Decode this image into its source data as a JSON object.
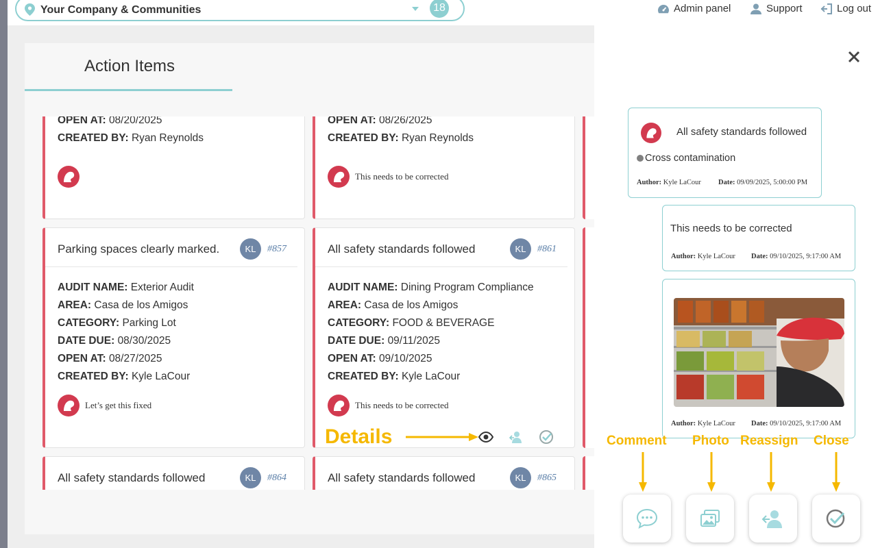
{
  "header": {
    "company_name": "Your Company & Communities",
    "count": "18",
    "admin_label": "Admin panel",
    "support_label": "Support",
    "logout_label": "Log out"
  },
  "panel": {
    "title": "Action Items"
  },
  "cards": {
    "top_left": {
      "open_at_label": "OPEN AT:",
      "open_at": "08/20/2025",
      "created_by_label": "CREATED BY:",
      "created_by": "Ryan Reynolds",
      "comment": ""
    },
    "top_mid": {
      "open_at_label": "OPEN AT:",
      "open_at": "08/26/2025",
      "created_by_label": "CREATED BY:",
      "created_by": "Ryan Reynolds",
      "comment": "This needs to be corrected"
    },
    "mid_left": {
      "title": "Parking spaces clearly marked.",
      "avatar": "KL",
      "number": "#857",
      "audit_label": "AUDIT NAME:",
      "audit": "Exterior Audit",
      "area_label": "AREA:",
      "area": "Casa de los Amigos",
      "category_label": "CATEGORY:",
      "category": "Parking Lot",
      "due_label": "DATE DUE:",
      "due": "08/30/2025",
      "open_at_label": "OPEN AT:",
      "open_at": "08/27/2025",
      "created_by_label": "CREATED BY:",
      "created_by": "Kyle LaCour",
      "comment": "Let’s get this fixed"
    },
    "mid_mid": {
      "title": "All safety standards followed",
      "avatar": "KL",
      "number": "#861",
      "audit_label": "AUDIT NAME:",
      "audit": "Dining Program Compliance",
      "area_label": "AREA:",
      "area": "Casa de los Amigos",
      "category_label": "CATEGORY:",
      "category": "FOOD & BEVERAGE",
      "due_label": "DATE DUE:",
      "due": "09/11/2025",
      "open_at_label": "OPEN AT:",
      "open_at": "09/10/2025",
      "created_by_label": "CREATED BY:",
      "created_by": "Kyle LaCour",
      "comment": "This needs to be corrected"
    },
    "bot_left": {
      "title": "All safety standards followed",
      "avatar": "KL",
      "number": "#864"
    },
    "bot_mid": {
      "title": "All safety standards followed",
      "avatar": "KL",
      "number": "#865"
    }
  },
  "annotations": {
    "details": "Details",
    "comment": "Comment",
    "photo": "Photo",
    "reassign": "Reassign",
    "close": "Close"
  },
  "detail": {
    "bubble1": {
      "title": "All safety standards followed",
      "tag": "Cross contamination",
      "author_label": "Author:",
      "author": "Kyle LaCour",
      "date_label": "Date:",
      "date": "09/09/2025, 5:00:00 PM"
    },
    "bubble2": {
      "text": "This needs to be corrected",
      "author_label": "Author:",
      "author": "Kyle LaCour",
      "date_label": "Date:",
      "date": "09/10/2025, 9:17:00 AM"
    },
    "bubble3": {
      "author_label": "Author:",
      "author": "Kyle LaCour",
      "date_label": "Date:",
      "date": "09/10/2025, 9:17:00 AM"
    }
  },
  "colors": {
    "accent": "#8dcfd1",
    "card_border": "#e05a6a",
    "annotation": "#f5b800",
    "avatar": "#6f86a6"
  }
}
